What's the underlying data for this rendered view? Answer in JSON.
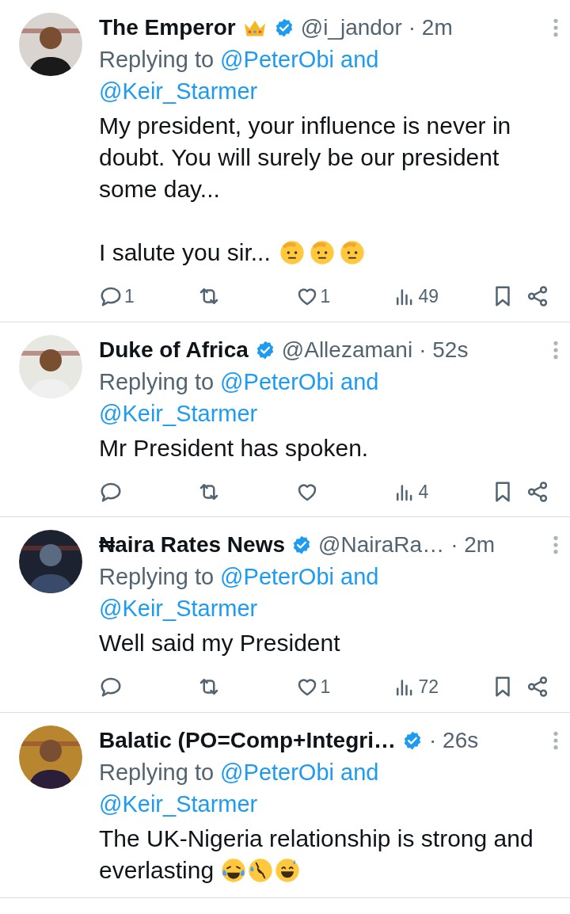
{
  "tweets": [
    {
      "name": "The Emperor",
      "name_emoji": {
        "kind": "crown"
      },
      "verified": true,
      "handle": "@i_jandor",
      "time": "· 2m",
      "avatar": {
        "kind": "picture"
      },
      "replying_prefix": "Replying to",
      "replying_to": [
        "@PeterObi and",
        "@Keir_Starmer"
      ],
      "paragraphs": [
        "My president, your influence is never in doubt. You will surely be our president some day...",
        "I salute you sir..."
      ],
      "emojis": [
        {
          "kind": "salute"
        },
        {
          "kind": "salute"
        },
        {
          "kind": "salute"
        }
      ],
      "actions": [
        {
          "kind": "reply",
          "count": "1"
        },
        {
          "kind": "retweet"
        },
        {
          "kind": "like",
          "count": "1"
        },
        {
          "kind": "views",
          "count": "49"
        },
        {
          "kind": "bookmark"
        },
        {
          "kind": "share"
        }
      ]
    },
    {
      "name": "Duke of Africa",
      "verified": true,
      "handle": "@Allezamani",
      "time": "· 52s",
      "avatar": {
        "kind": "picture"
      },
      "replying_prefix": "Replying to",
      "replying_to": [
        "@PeterObi and",
        "@Keir_Starmer"
      ],
      "paragraphs": [
        "Mr President has spoken."
      ],
      "actions": [
        {
          "kind": "reply"
        },
        {
          "kind": "retweet"
        },
        {
          "kind": "like"
        },
        {
          "kind": "views",
          "count": "4"
        },
        {
          "kind": "bookmark"
        },
        {
          "kind": "share"
        }
      ]
    },
    {
      "name": "₦aira Rates News",
      "verified": true,
      "handle": "@NairaRa…",
      "time": "· 2m",
      "avatar": {
        "kind": "picture"
      },
      "replying_prefix": "Replying to",
      "replying_to": [
        "@PeterObi and",
        "@Keir_Starmer"
      ],
      "paragraphs": [
        "Well said my President"
      ],
      "actions": [
        {
          "kind": "reply"
        },
        {
          "kind": "retweet"
        },
        {
          "kind": "like",
          "count": "1"
        },
        {
          "kind": "views",
          "count": "72"
        },
        {
          "kind": "bookmark"
        },
        {
          "kind": "share"
        }
      ]
    },
    {
      "name": "Balatic (PO=Comp+Integri…",
      "verified": true,
      "time": "· 26s",
      "avatar": {
        "kind": "picture"
      },
      "replying_prefix": "Replying to",
      "replying_to": [
        "@PeterObi and",
        "@Keir_Starmer"
      ],
      "paragraphs": [
        "The UK-Nigeria relationship is strong and everlasting"
      ],
      "emojis": [
        {
          "kind": "joy"
        },
        {
          "kind": "rofl"
        },
        {
          "kind": "sweat_smile"
        }
      ]
    }
  ]
}
